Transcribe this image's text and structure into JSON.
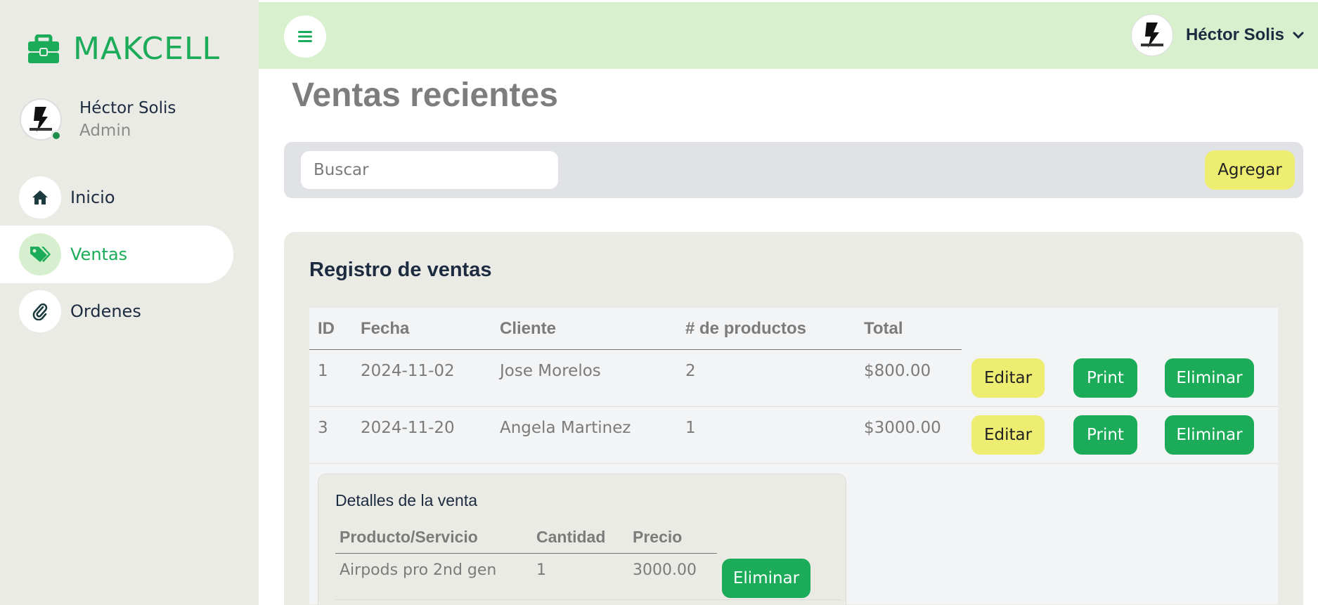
{
  "brand": {
    "name": "MAKCELL"
  },
  "user": {
    "name": "Héctor Solis",
    "role": "Admin"
  },
  "nav": {
    "items": [
      {
        "label": "Inicio",
        "icon": "home-icon",
        "active": false
      },
      {
        "label": "Ventas",
        "icon": "tags-icon",
        "active": true
      },
      {
        "label": "Ordenes",
        "icon": "paperclip-icon",
        "active": false
      }
    ]
  },
  "topbar": {
    "user_name": "Héctor Solis"
  },
  "page": {
    "title": "Ventas recientes"
  },
  "search": {
    "placeholder": "Buscar",
    "add_label": "Agregar"
  },
  "card": {
    "title": "Registro de ventas",
    "columns": [
      "ID",
      "Fecha",
      "Cliente",
      "# de productos",
      "Total"
    ],
    "rows": [
      {
        "id": "1",
        "fecha": "2024-11-02",
        "cliente": "Jose Morelos",
        "productos": "2",
        "total": "$800.00"
      },
      {
        "id": "3",
        "fecha": "2024-11-20",
        "cliente": "Angela Martinez",
        "productos": "1",
        "total": "$3000.00"
      }
    ],
    "actions": {
      "edit": "Editar",
      "print": "Print",
      "delete": "Eliminar"
    }
  },
  "details": {
    "title": "Detalles de la venta",
    "columns": [
      "Producto/Servicio",
      "Cantidad",
      "Precio"
    ],
    "rows": [
      {
        "producto": "Airpods pro 2nd gen",
        "cantidad": "1",
        "precio": "3000.00"
      }
    ],
    "delete_label": "Eliminar"
  },
  "colors": {
    "brand_green": "#1bab59",
    "topbar_bg": "#d9f0ce",
    "sidebar_bg": "#ebebe6",
    "yellow_button": "#eded72"
  }
}
